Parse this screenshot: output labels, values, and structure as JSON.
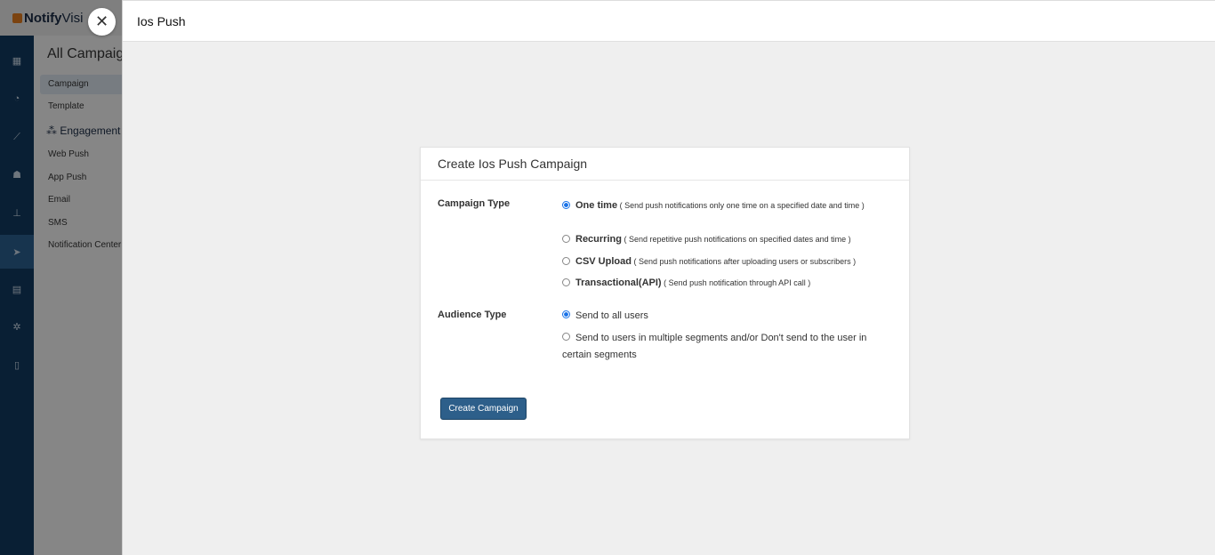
{
  "app": {
    "logo_main": "Notify",
    "logo_accent": "Visi",
    "subnav_title": "All Campaign",
    "subnav_items": [
      "Campaign",
      "Template"
    ],
    "engagement_section": "Engagement",
    "engagement_items": [
      "Web Push",
      "App Push",
      "Email",
      "SMS",
      "Notification Center"
    ]
  },
  "sheet": {
    "title": "Ios Push",
    "close_icon": "close-icon"
  },
  "card": {
    "title": "Create Ios Push Campaign",
    "campaign_type_label": "Campaign Type",
    "campaign_options": [
      {
        "name": "One time",
        "desc": "( Send push notifications only one time on a specified date and time )",
        "checked": true
      },
      {
        "name": "Recurring",
        "desc": "( Send repetitive push notifications on specified dates and time )",
        "checked": false
      },
      {
        "name": "CSV Upload",
        "desc": "( Send push notifications after uploading users or subscribers )",
        "checked": false
      },
      {
        "name": "Transactional(API)",
        "desc": "( Send push notification through API call )",
        "checked": false
      }
    ],
    "audience_type_label": "Audience Type",
    "audience_options": [
      {
        "text": "Send to all users",
        "checked": true
      },
      {
        "text": "Send to users in multiple segments and/or Don't send to the user in certain segments",
        "checked": false
      }
    ],
    "create_button": "Create Campaign"
  },
  "colors": {
    "primary_button": "#2d5f8a",
    "icon_rail": "#123a5f",
    "radio_checked": "#1a73e8"
  }
}
